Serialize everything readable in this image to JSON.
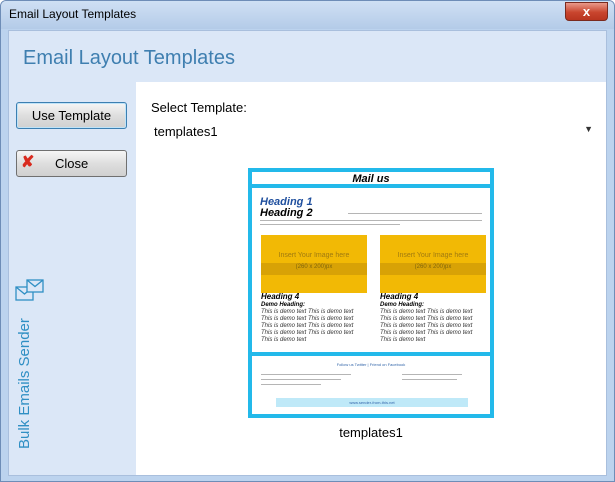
{
  "window": {
    "title": "Email Layout Templates",
    "close_glyph": "x"
  },
  "header": {
    "title": "Email Layout Templates"
  },
  "sidebar": {
    "use_template_label": "Use Template",
    "close_label": "Close",
    "close_icon_glyph": "✘",
    "brand_text": "Bulk Emails Sender"
  },
  "main": {
    "select_label": "Select Template:",
    "selected_template": "templates1",
    "caption": "templates1"
  },
  "preview": {
    "mail_us": "Mail us",
    "heading1": "Heading 1",
    "heading2": "Heading 2",
    "image_text": "Insert Your Image here",
    "image_size": "(260 x 200)px",
    "heading4": "Heading 4",
    "demo_heading": "Demo Heading:",
    "demo_text": "This is demo text This is demo text This is demo text This is demo text This is demo text This is demo text This is demo text This is demo text This is demo text",
    "footer_links": "Follow us Twitter | Friend on Facebook",
    "footer_bar": "www.sender-from-this.net"
  },
  "colors": {
    "accent": "#23b9ea",
    "title_blue": "#3f7fb0",
    "brand_blue": "#2f8fc4"
  }
}
